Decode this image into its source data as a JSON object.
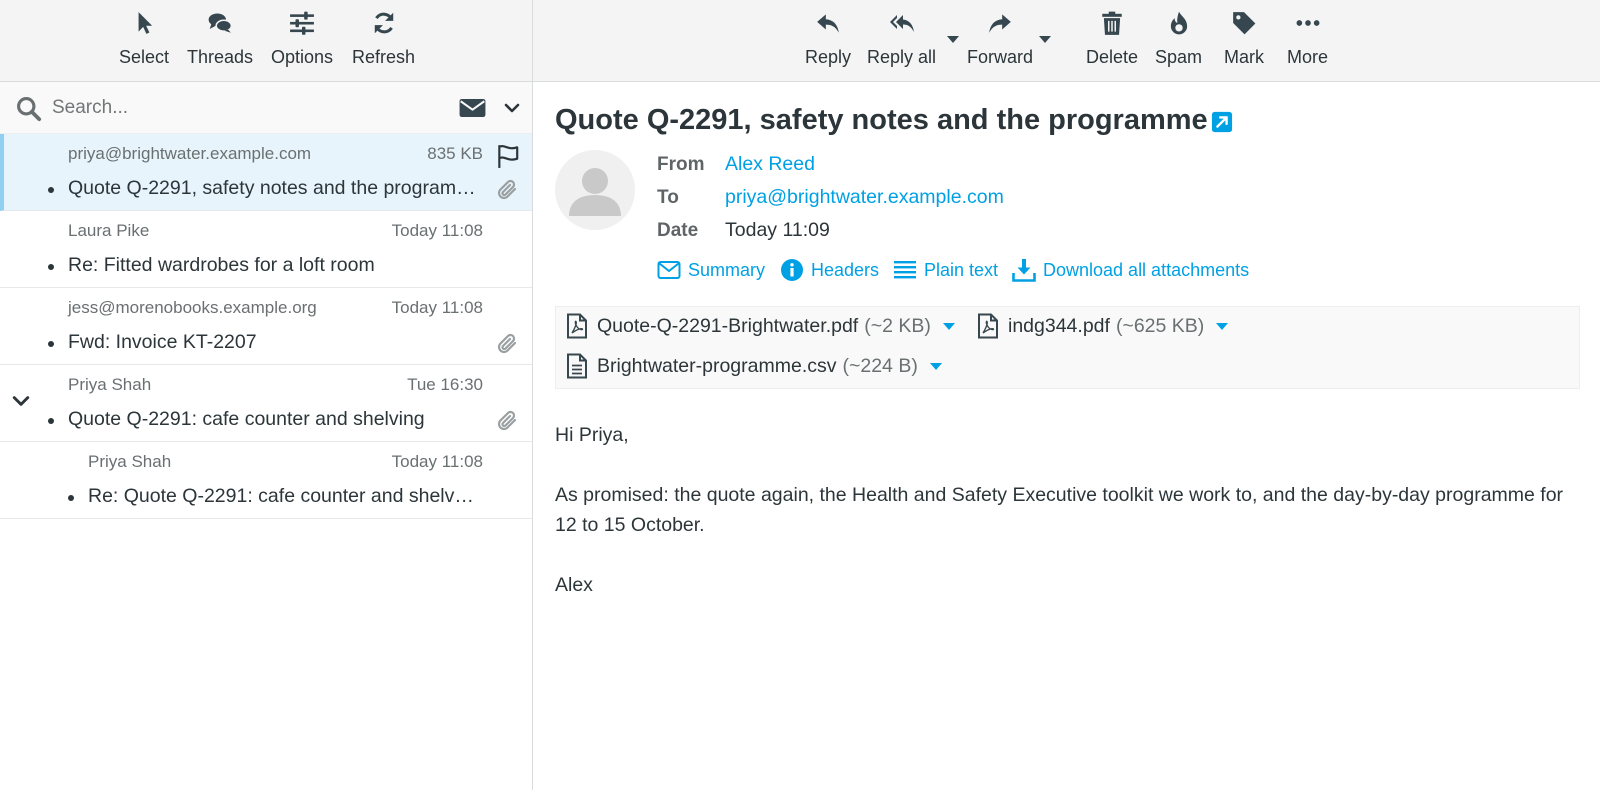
{
  "list_toolbar": {
    "select": "Select",
    "threads": "Threads",
    "options": "Options",
    "refresh": "Refresh"
  },
  "search": {
    "placeholder": "Search..."
  },
  "messages": [
    {
      "from": "priya@brightwater.example.com",
      "meta": "835 KB",
      "subject": "Quote Q-2291, safety notes and the programme",
      "selected": true,
      "flagged": true,
      "attachment": true
    },
    {
      "from": "Laura Pike",
      "meta": "Today 11:08",
      "subject": "Re: Fitted wardrobes for a loft room",
      "attachment": false
    },
    {
      "from": "jess@morenobooks.example.org",
      "meta": "Today 11:08",
      "subject": "Fwd: Invoice KT-2207",
      "attachment": true
    },
    {
      "from": "Priya Shah",
      "meta": "Tue 16:30",
      "subject": "Quote Q-2291: cafe counter and shelving",
      "attachment": true,
      "thread_expanded": true
    },
    {
      "from": "Priya Shah",
      "meta": "Today 11:08",
      "subject": "Re: Quote Q-2291: cafe counter and shelving",
      "attachment": false,
      "thread_child": true
    }
  ],
  "message_toolbar": {
    "reply": "Reply",
    "reply_all": "Reply all",
    "forward": "Forward",
    "delete": "Delete",
    "spam": "Spam",
    "mark": "Mark",
    "more": "More"
  },
  "message": {
    "subject": "Quote Q-2291, safety notes and the programme",
    "from_label": "From",
    "from": "Alex Reed",
    "to_label": "To",
    "to": "priya@brightwater.example.com",
    "date_label": "Date",
    "date": "Today 11:09",
    "header_links": {
      "summary": "Summary",
      "headers": "Headers",
      "plain_text": "Plain text",
      "download_all": "Download all attachments"
    },
    "attachments": [
      {
        "name": "Quote-Q-2291-Brightwater.pdf",
        "size": "(~2 KB)",
        "icon": "pdf-file-icon"
      },
      {
        "name": "indg344.pdf",
        "size": "(~625 KB)",
        "icon": "pdf-file-icon"
      },
      {
        "name": "Brightwater-programme.csv",
        "size": "(~224 B)",
        "icon": "text-file-icon"
      }
    ],
    "body": {
      "greeting": "Hi Priya,",
      "paragraph": "As promised: the quote again, the Health and Safety Executive toolkit we work to, and the day-by-day programme for 12 to 15 October.",
      "signoff": "Alex"
    }
  },
  "colors": {
    "accent": "#00a1e4",
    "selected_row": "#e8f4fb",
    "selected_border": "#8fd0f2",
    "toolbar_bg": "#f4f4f4",
    "text": "#2c363a"
  }
}
